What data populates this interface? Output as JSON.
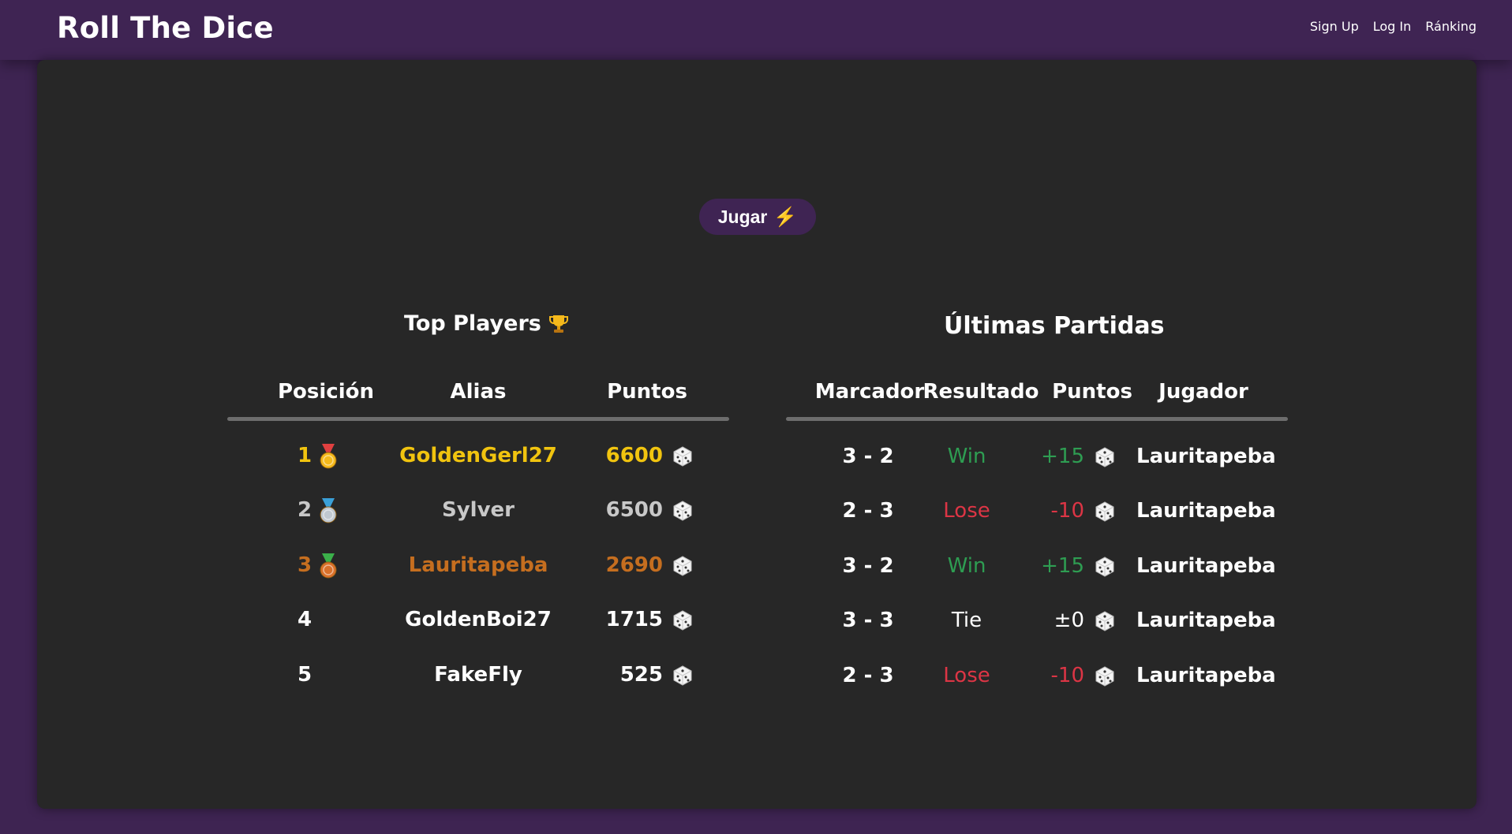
{
  "nav": {
    "brand": "Roll The Dice",
    "links": [
      "Sign Up",
      "Log In",
      "Ránking"
    ]
  },
  "play_button": {
    "label": "Jugar",
    "icon": "lightning-icon"
  },
  "top_players": {
    "title": "Top Players",
    "title_icon": "trophy-icon",
    "headers": [
      "Posición",
      "Alias",
      "Puntos"
    ],
    "rows": [
      {
        "position": "1",
        "medal": "gold-medal-icon",
        "alias": "GoldenGerl27",
        "points": "6600",
        "color": "#f1c40f"
      },
      {
        "position": "2",
        "medal": "silver-medal-icon",
        "alias": "Sylver",
        "points": "6500",
        "color": "#c8c8c8"
      },
      {
        "position": "3",
        "medal": "bronze-medal-icon",
        "alias": "Lauritapeba",
        "points": "2690",
        "color": "#c56e1f"
      },
      {
        "position": "4",
        "medal": "",
        "alias": "GoldenBoi27",
        "points": "1715",
        "color": "#ffffff"
      },
      {
        "position": "5",
        "medal": "",
        "alias": "FakeFly",
        "points": "525",
        "color": "#ffffff"
      }
    ]
  },
  "recent_games": {
    "title": "Últimas Partidas",
    "headers": [
      "Marcador",
      "Resultado",
      "Puntos",
      "Jugador"
    ],
    "rows": [
      {
        "score": "3 - 2",
        "result": "Win",
        "points": "+15",
        "player": "Lauritapeba",
        "color": "#2e9d52"
      },
      {
        "score": "2 - 3",
        "result": "Lose",
        "points": "-10",
        "player": "Lauritapeba",
        "color": "#dc3545"
      },
      {
        "score": "3 - 2",
        "result": "Win",
        "points": "+15",
        "player": "Lauritapeba",
        "color": "#2e9d52"
      },
      {
        "score": "3 - 3",
        "result": "Tie",
        "points": "±0",
        "player": "Lauritapeba",
        "color": "#ffffff"
      },
      {
        "score": "2 - 3",
        "result": "Lose",
        "points": "-10",
        "player": "Lauritapeba",
        "color": "#dc3545"
      }
    ]
  },
  "colors": {
    "page_bg": "#3e2452",
    "panel_bg": "#272727",
    "accent": "#3f2453"
  }
}
